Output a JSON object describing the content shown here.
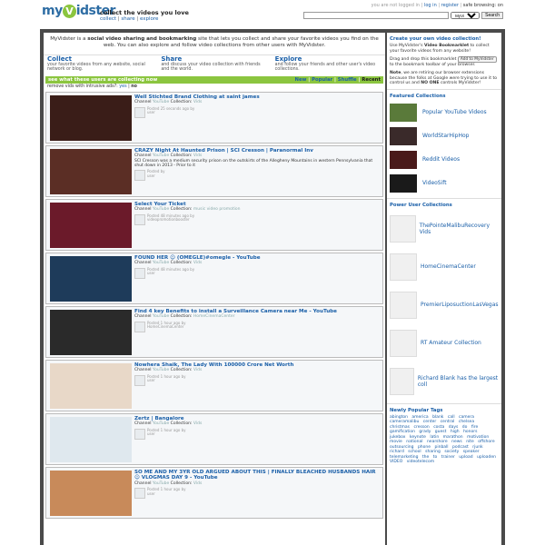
{
  "header": {
    "logo": "MyVidster",
    "tagline": "collect the videos you love",
    "nav": [
      "collect",
      "share",
      "explore"
    ],
    "login_prefix": "you are not logged in",
    "login_links": [
      "log in",
      "register"
    ],
    "safe_browsing": "safe browsing: on",
    "search_select": "MyVidster",
    "search_button": "Search"
  },
  "intro": {
    "brand": "MyVidster",
    "text_1": " is a ",
    "emph": "social video sharing and bookmarking",
    "text_2": " site that lets you collect and share your favorite videos you find on the web. You can also explore and follow video collections from other users with MyVidster."
  },
  "cse": [
    {
      "heading": "Collect",
      "text": "your favorite videos from any website, social network or blog."
    },
    {
      "heading": "Share",
      "text": "and discuss your video collection with friends and the world."
    },
    {
      "heading": "Explore",
      "text": "and follow your friends and other user's video collections."
    }
  ],
  "feed": {
    "bar_title": "see what these users are collecting now",
    "filters": [
      "New",
      "Popular",
      "Shuffle",
      "Recent"
    ],
    "intrusive_label": "remove vids with intrusive ads?:",
    "intrusive_yes": "yes",
    "intrusive_no": "no"
  },
  "items": [
    {
      "title": "Well Stichted Brand Clothing at saint james",
      "channel": "Channel",
      "channel_val": "YouTube",
      "collection": "Collection:",
      "collection_val": "Vids",
      "posted": "Posted 25 seconds ago by",
      "user": "user"
    },
    {
      "title": "CRAZY Night At Haunted Prison | SCI Cresson | Paranormal Inv",
      "channel": "Channel",
      "channel_val": "YouTube",
      "collection": "Collection:",
      "collection_val": "Vids",
      "desc": "SCI Cresson was a medium security prison on the outskirts of the Allegheny Mountains in western Pennsylvania that shut down in 2013 - Prior to it",
      "posted": "Posted by",
      "user": "user"
    },
    {
      "title": "Select Your Ticket",
      "channel": "Channel",
      "channel_val": "YouTube",
      "collection": "Collection:",
      "collection_val": "music video promotion",
      "posted": "Posted 48 minutes ago by",
      "user": "videopromotionbooster"
    },
    {
      "title": "FOUND HER ☺ (OMEGLE)#omegle - YouTube",
      "channel": "Channel",
      "channel_val": "YouTube",
      "collection": "Collection:",
      "collection_val": "Vids",
      "posted": "Posted 48 minutes ago by",
      "user": "user"
    },
    {
      "title": "Find 4 key Benefits to install a Surveillance Camera near Me - YouTube",
      "channel": "Channel",
      "channel_val": "YouTube",
      "collection": "Collection:",
      "collection_val": "HomeCinemaCenter",
      "posted": "Posted 1 hour ago by",
      "user": "HomeCinemaCenter"
    },
    {
      "title": "Nowhera Shaik, The Lady With 100000 Crore Net Worth",
      "channel": "Channel",
      "channel_val": "YouTube",
      "collection": "Collection:",
      "collection_val": "Vids",
      "posted": "Posted 1 hour ago by",
      "user": "user"
    },
    {
      "title": "Zertz | Bangalore",
      "channel": "Channel",
      "channel_val": "YouTube",
      "collection": "Collection:",
      "collection_val": "Vids",
      "posted": "Posted 1 hour ago by",
      "user": "user"
    },
    {
      "title": "SO ME AND MY 3YR OLD ARGUED ABOUT THIS | FINALLY BLEACHED HUSBANDS HAIR ☺ VLOGMAS DAY 9 - YouTube",
      "channel": "Channel",
      "channel_val": "YouTube",
      "collection": "Collection:",
      "collection_val": "Vids",
      "posted": "Posted 1 hour ago by",
      "user": "user"
    }
  ],
  "sidebar": {
    "create_heading": "Create your own video collection!",
    "create_text_1": "Use MyVidster's ",
    "create_bold": "Video Bookmarklet",
    "create_text_2": " to collect your favorite videos from any website!",
    "drag_text_1": "Drag and drop this bookmarklet",
    "bookmarklet_btn": "Add to MyVidster",
    "drag_text_2": "to the bookmark toolbar of your browser.",
    "note_label": "Note",
    "note_text": ", we are retiring our browser extensions because the folks at Google were trying to use it to control us and ",
    "note_bold": "NO ONE",
    "note_end": " controls MyVidster!",
    "featured_heading": "Featured Collections",
    "featured": [
      "Popular YouTube Videos",
      "WorldStarHipHop",
      "Reddit Videos",
      "VideoSift"
    ],
    "power_heading": "Power User Collections",
    "power": [
      "ThePointeMalibuRecovery Vids",
      "HomeCinemaCenter",
      "PremierLiposuctionLasVegas",
      "RT Amateur Collection",
      "Richard Blank has the largest coll"
    ],
    "tags_heading": "Newly Popular Tags",
    "tags": [
      "abington",
      "america",
      "blank",
      "call",
      "camera",
      "cameramalibu",
      "center",
      "central",
      "chelsea",
      "christmas",
      "cresson",
      "costa",
      "days",
      "do",
      "fire",
      "gamification",
      "grady",
      "guest",
      "high",
      "honors",
      "jukebox",
      "keynote",
      "latin",
      "marathon",
      "motivation",
      "movie",
      "national",
      "nearshore",
      "news",
      "nite",
      "offshore",
      "outsourcing",
      "phone",
      "pinball",
      "podcast",
      "rjunk",
      "richard",
      "school",
      "sharing",
      "society",
      "speaker",
      "telemarketing",
      "the",
      "to",
      "trainer",
      "upload",
      "uploaden",
      "VIDEO",
      "videotelecom"
    ]
  },
  "colors": {
    "accent": "#8bc53f",
    "link": "#1a5fa8",
    "frame": "#4a4a4a"
  }
}
